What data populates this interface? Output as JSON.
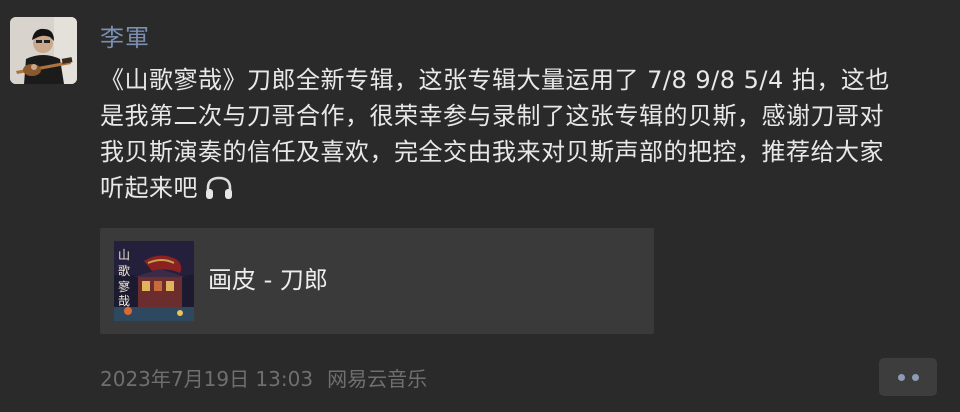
{
  "post": {
    "author": "李軍",
    "content_lines": [
      "《山歌寥哉》刀郎全新专辑，这张专辑大量运用了 7/8 9/8 5/4 拍，这也",
      "是我第二次与刀哥合作，很荣幸参与录制了这张专辑的贝斯，感谢刀哥对",
      "我贝斯演奏的信任及喜欢，完全交由我来对贝斯声部的把控，推荐给大家",
      "听起来吧"
    ],
    "trailing_emoji": "headphones-icon",
    "music_card": {
      "title": "画皮 - 刀郎",
      "cover_icon": "album-cover-image"
    },
    "timestamp": "2023年7月19日 13:03",
    "source": "网易云音乐",
    "more_icon": "more-dots-icon"
  },
  "colors": {
    "background": "#2a2a2a",
    "author_name": "#7a8fb2",
    "body_text": "#e8e8e8",
    "card_bg": "#3a3a3a",
    "meta_text": "#6f6f6f",
    "more_dots": "#8e9bb5"
  }
}
